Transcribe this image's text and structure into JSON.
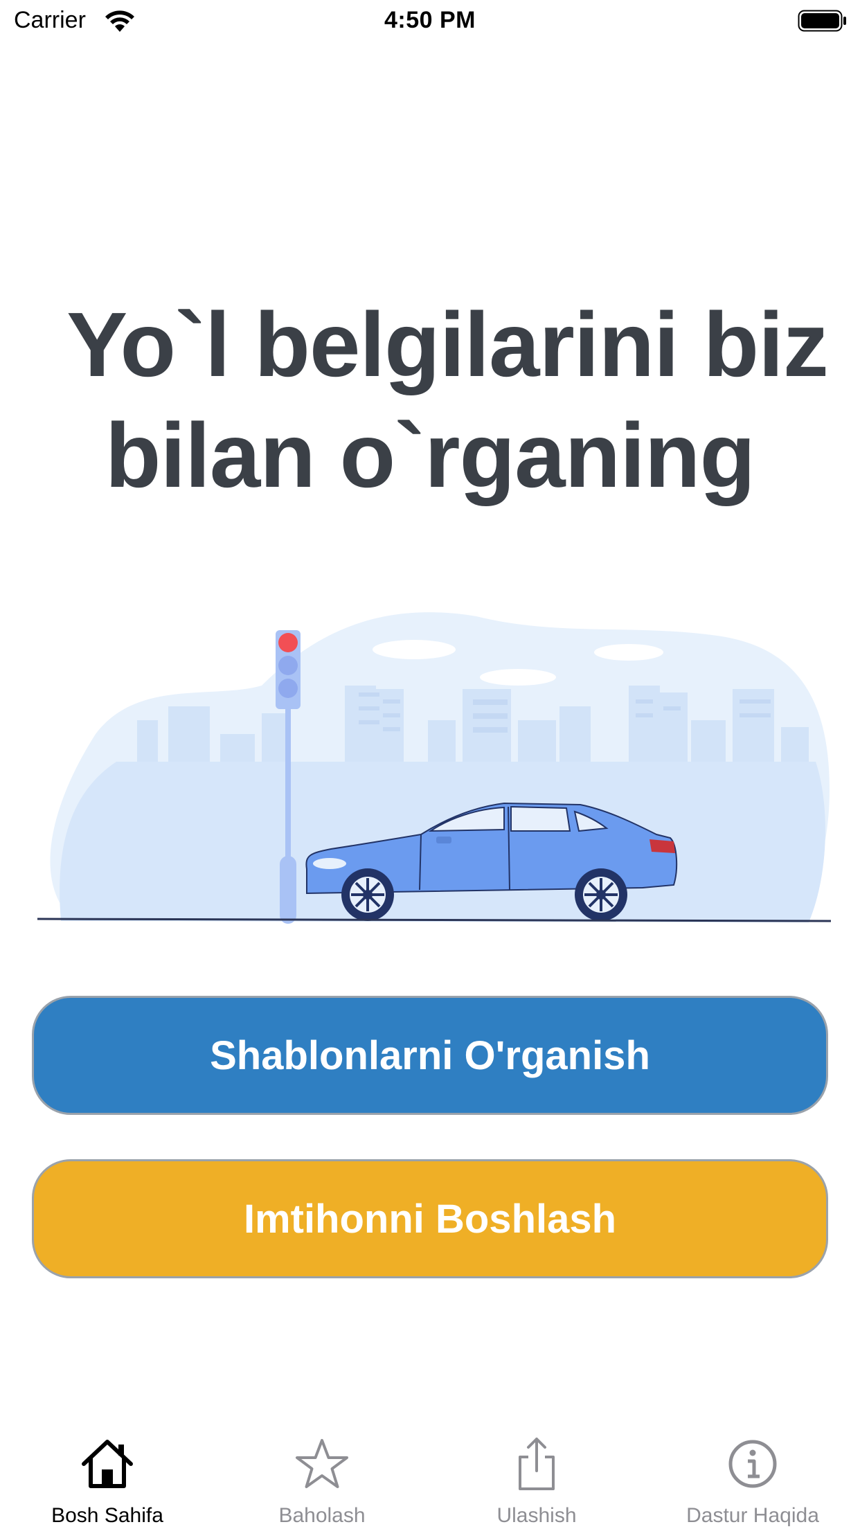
{
  "status_bar": {
    "carrier": "Carrier",
    "time": "4:50 PM",
    "icons": [
      "wifi-icon",
      "battery-icon"
    ]
  },
  "headline": {
    "line1": "Yo`l belgilarini biz",
    "line2": "bilan o`rganing",
    "color": "#3b4047"
  },
  "illustration": {
    "icons": [
      "traffic-light-icon",
      "car-icon",
      "city-skyline-icon"
    ]
  },
  "buttons": {
    "learn_label": "Shablonlarni O'rganish",
    "learn_color": "#2f7fc2",
    "exam_label": "Imtihonni Boshlash",
    "exam_color": "#efaf26"
  },
  "tab_bar": {
    "items": [
      {
        "label": "Bosh Sahifa",
        "icon": "house-icon",
        "active": true
      },
      {
        "label": "Baholash",
        "icon": "star-icon",
        "active": false
      },
      {
        "label": "Ulashish",
        "icon": "share-icon",
        "active": false
      },
      {
        "label": "Dastur Haqida",
        "icon": "info-icon",
        "active": false
      }
    ],
    "active_color": "#000000",
    "inactive_color": "#8e8e93"
  }
}
